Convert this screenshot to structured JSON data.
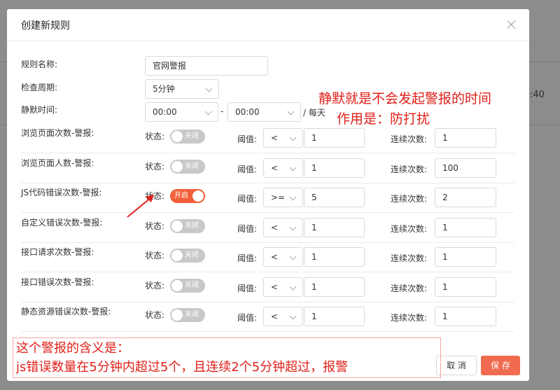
{
  "background": {
    "time_fragment": ":40"
  },
  "modal": {
    "title": "创建新规则",
    "close_label": "close"
  },
  "form": {
    "rule_name_label": "规则名称:",
    "rule_name_value": "官网警报",
    "period_label": "检查周期:",
    "period_value": "5分钟",
    "silence_label": "静默时间:",
    "silence_start": "00:00",
    "silence_sep": "-",
    "silence_end": "00:00",
    "silence_suffix": "/ 每天"
  },
  "common": {
    "status_label": "状态:",
    "threshold_label": "阈值:",
    "consecutive_label": "连续次数:",
    "on_text": "开启",
    "off_text": "关闭"
  },
  "alerts": [
    {
      "label": "浏览页面次数-警报:",
      "enabled": false,
      "operator": "<",
      "threshold": "1",
      "consecutive": "1"
    },
    {
      "label": "浏览页面人数-警报:",
      "enabled": false,
      "operator": "<",
      "threshold": "1",
      "consecutive": "100"
    },
    {
      "label": "JS代码错误次数-警报:",
      "enabled": true,
      "operator": ">=",
      "threshold": "5",
      "consecutive": "2"
    },
    {
      "label": "自定义错误次数-警报:",
      "enabled": false,
      "operator": "<",
      "threshold": "1",
      "consecutive": "1"
    },
    {
      "label": "接口请求次数-警报:",
      "enabled": false,
      "operator": "<",
      "threshold": "1",
      "consecutive": "1"
    },
    {
      "label": "接口错误次数-警报:",
      "enabled": false,
      "operator": "<",
      "threshold": "1",
      "consecutive": "1"
    },
    {
      "label": "静态资源错误次数-警报:",
      "enabled": false,
      "operator": "<",
      "threshold": "1",
      "consecutive": "1"
    }
  ],
  "footer": {
    "cancel_label": "取 消",
    "save_label": "保 存"
  },
  "annotations": {
    "silence_note_line1": "静默就是不会发起警报的时间",
    "silence_note_line2": "作用是：防打扰",
    "meaning_line1": "这个警报的含义是：",
    "meaning_line2": "js错误数量在5分钟内超过5个，且连续2个5分钟超过，报警",
    "color": "#e0201a"
  }
}
